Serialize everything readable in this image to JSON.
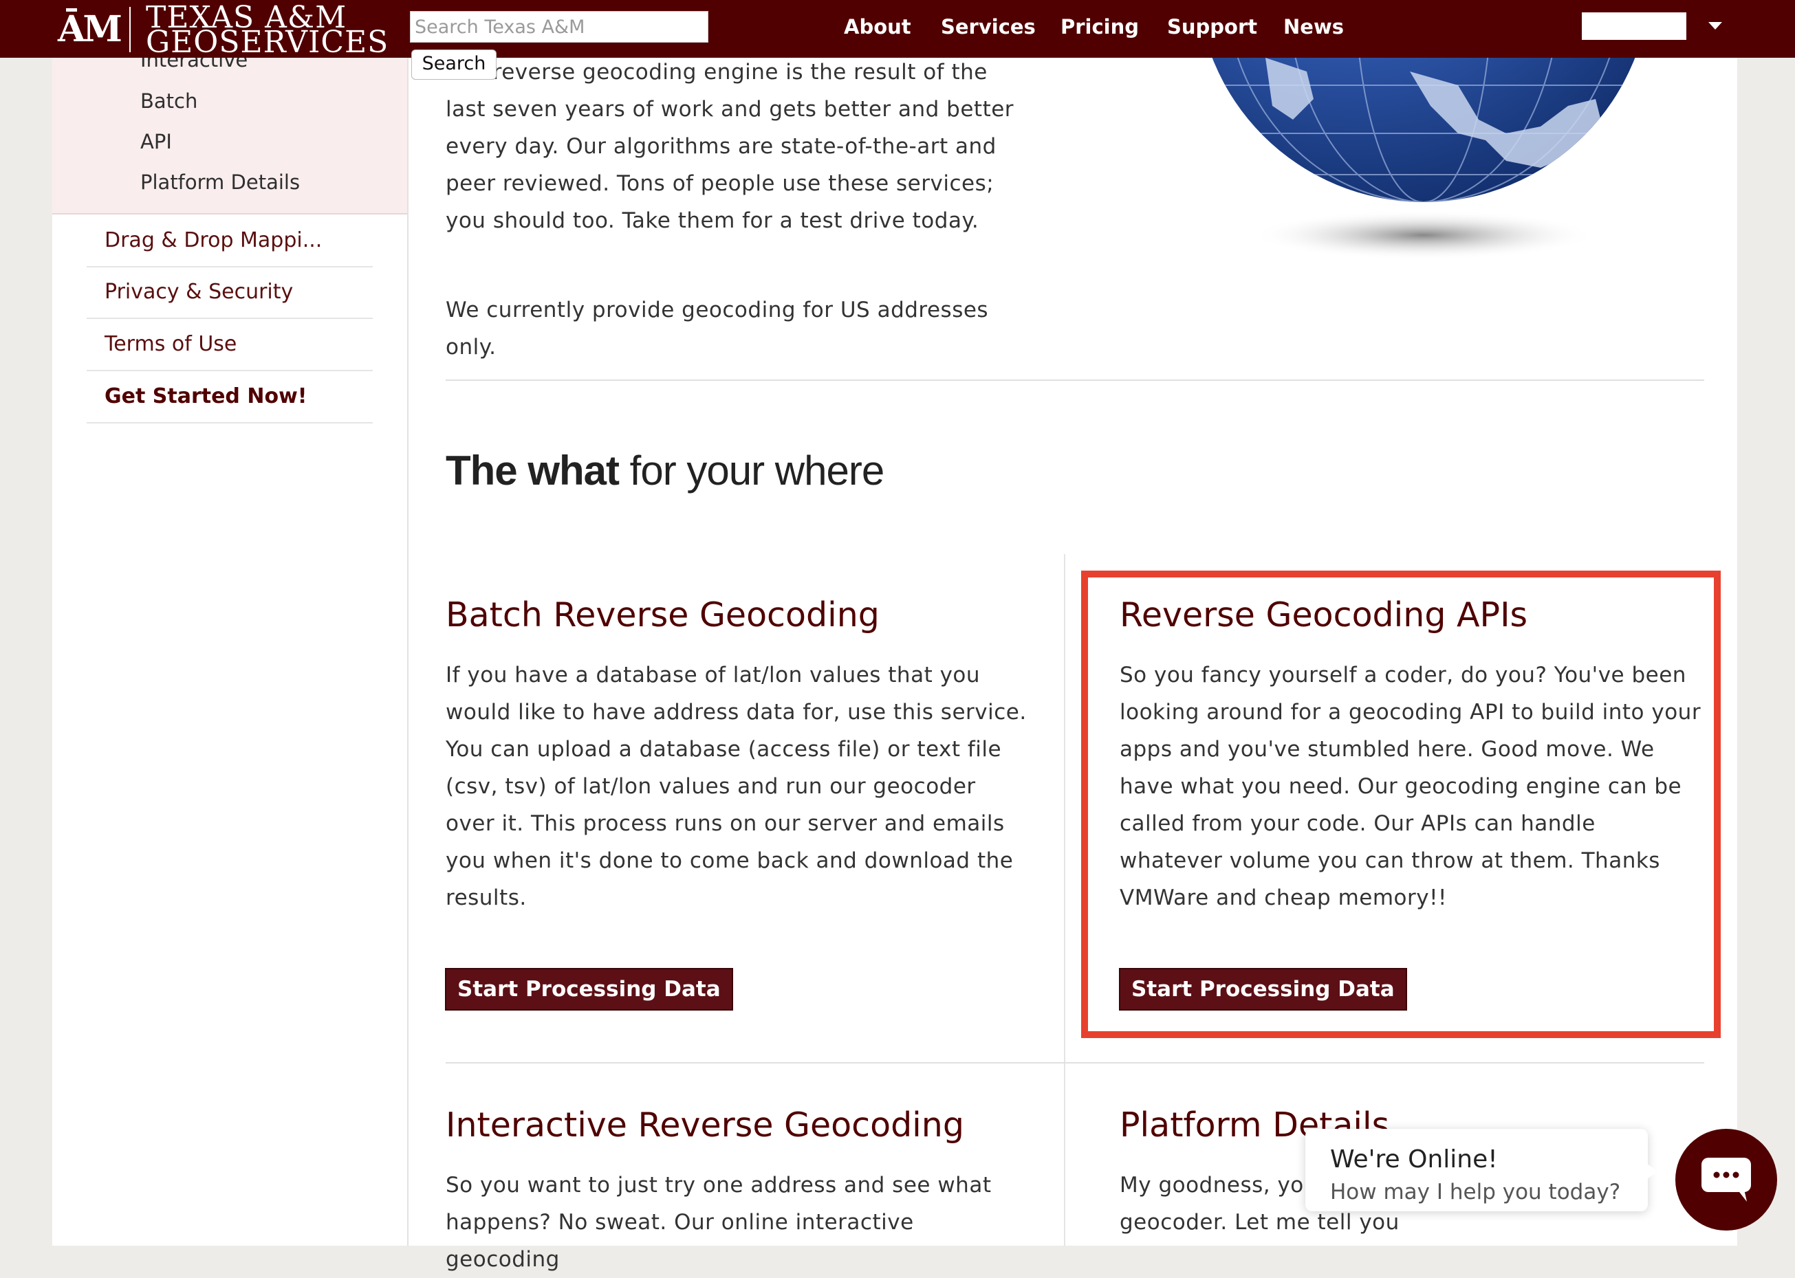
{
  "brand": {
    "mark": "ĀM",
    "line1": "TEXAS A&M",
    "line2": "GEOSERVICES"
  },
  "search": {
    "placeholder": "Search Texas A&M",
    "button_label": "Search"
  },
  "nav": {
    "items": [
      "About",
      "Services",
      "Pricing",
      "Support",
      "News"
    ]
  },
  "sidebar": {
    "sub_items": [
      "Interactive",
      "Batch",
      "API",
      "Platform Details"
    ],
    "items": [
      "Drag & Drop Mappi...",
      "Privacy & Security",
      "Terms of Use",
      "Get Started Now!"
    ]
  },
  "intro": {
    "paragraph": "Our reverse geocoding engine is the result of the last seven years of work and gets better and better every day. Our algorithms are state-of-the-art and peer reviewed. Tons of people use these services; you should too. Take them for a test drive today.",
    "note": "We currently provide geocoding for US addresses only."
  },
  "section": {
    "title_bold": "The what",
    "title_rest": " for your where"
  },
  "cards": [
    {
      "title": "Batch Reverse Geocoding",
      "text": "If you have a database of lat/lon values that you would like to have address data for, use this service. You can upload a database (access file) or text file (csv, tsv) of lat/lon values and run our geocoder over it. This process runs on our server and emails you when it's done to come back and download the results.",
      "button": "Start Processing Data"
    },
    {
      "title": "Reverse Geocoding APIs",
      "text": "So you fancy yourself a coder, do you? You've been looking around for a geocoding API to build into your apps and you've stumbled here. Good move. We have what you need. Our geocoding engine can be called from your code. Our APIs can handle whatever volume you can throw at them. Thanks VMWare and cheap memory!!",
      "button": "Start Processing Data"
    },
    {
      "title": "Interactive Reverse Geocoding",
      "text": "So you want to just try one address and see what happens? No sweat. Our online interactive geocoding"
    },
    {
      "title": "Platform Details",
      "text": "My goodness, you what's happening inside the geocoder. Let me tell you"
    }
  ],
  "chat": {
    "title": "We're Online!",
    "subtitle": "How may I help you today?"
  },
  "colors": {
    "maroon": "#500000",
    "highlight": "#e8402f"
  },
  "icons": [
    "chevron-down-icon",
    "chat-icon",
    "globe-image"
  ]
}
